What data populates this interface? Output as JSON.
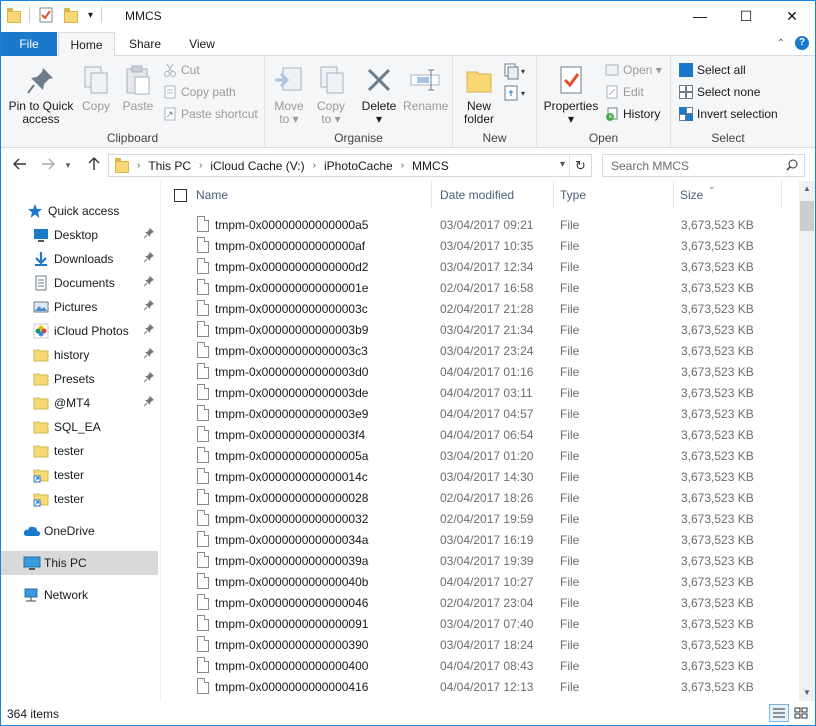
{
  "window": {
    "title": "MMCS",
    "minimize": "—",
    "maximize": "☐",
    "close": "✕"
  },
  "ribbon_tabs": {
    "file": "File",
    "home": "Home",
    "share": "Share",
    "view": "View"
  },
  "ribbon": {
    "clipboard": {
      "label": "Clipboard",
      "pin_line1": "Pin to Quick",
      "pin_line2": "access",
      "copy": "Copy",
      "paste": "Paste",
      "cut": "Cut",
      "copy_path": "Copy path",
      "paste_shortcut": "Paste shortcut"
    },
    "organise": {
      "label": "Organise",
      "move_to_1": "Move",
      "move_to_2": "to ▾",
      "copy_to_1": "Copy",
      "copy_to_2": "to ▾",
      "delete": "Delete",
      "delete_arrow": "▾",
      "rename": "Rename"
    },
    "new": {
      "label": "New",
      "new_folder_1": "New",
      "new_folder_2": "folder"
    },
    "open": {
      "label": "Open",
      "properties": "Properties",
      "properties_arrow": "▾",
      "open": "Open ▾",
      "edit": "Edit",
      "history": "History"
    },
    "select": {
      "label": "Select",
      "select_all": "Select all",
      "select_none": "Select none",
      "invert_selection": "Invert selection"
    }
  },
  "address": {
    "crumbs": [
      "This PC",
      "iCloud Cache (V:)",
      "iPhotoCache",
      "MMCS"
    ],
    "search_placeholder": "Search MMCS"
  },
  "nav": {
    "quick_access": "Quick access",
    "items": [
      {
        "label": "Desktop",
        "icon": "desktop-icon",
        "pinned": true
      },
      {
        "label": "Downloads",
        "icon": "downloads-icon",
        "pinned": true
      },
      {
        "label": "Documents",
        "icon": "documents-icon",
        "pinned": true
      },
      {
        "label": "Pictures",
        "icon": "pictures-icon",
        "pinned": true
      },
      {
        "label": "iCloud Photos",
        "icon": "icloud-photos-icon",
        "pinned": true
      },
      {
        "label": "history",
        "icon": "folder-icon",
        "pinned": true
      },
      {
        "label": "Presets",
        "icon": "folder-icon",
        "pinned": true
      },
      {
        "label": "@MT4",
        "icon": "folder-icon",
        "pinned": true
      },
      {
        "label": "SQL_EA",
        "icon": "folder-icon",
        "pinned": false
      },
      {
        "label": "tester",
        "icon": "folder-icon",
        "pinned": false
      },
      {
        "label": "tester",
        "icon": "folder-shortcut-icon",
        "pinned": false
      },
      {
        "label": "tester",
        "icon": "folder-shortcut-icon",
        "pinned": false
      }
    ],
    "onedrive": "OneDrive",
    "this_pc": "This PC",
    "network": "Network",
    "pin_glyph": "📌"
  },
  "columns": {
    "name": "Name",
    "date_modified": "Date modified",
    "type": "Type",
    "size": "Size"
  },
  "files": [
    {
      "name": "tmpm-0x00000000000000a5",
      "date": "03/04/2017 09:21",
      "type": "File",
      "size": "3,673,523 KB"
    },
    {
      "name": "tmpm-0x00000000000000af",
      "date": "03/04/2017 10:35",
      "type": "File",
      "size": "3,673,523 KB"
    },
    {
      "name": "tmpm-0x00000000000000d2",
      "date": "03/04/2017 12:34",
      "type": "File",
      "size": "3,673,523 KB"
    },
    {
      "name": "tmpm-0x000000000000001e",
      "date": "02/04/2017 16:58",
      "type": "File",
      "size": "3,673,523 KB"
    },
    {
      "name": "tmpm-0x000000000000003c",
      "date": "02/04/2017 21:28",
      "type": "File",
      "size": "3,673,523 KB"
    },
    {
      "name": "tmpm-0x00000000000003b9",
      "date": "03/04/2017 21:34",
      "type": "File",
      "size": "3,673,523 KB"
    },
    {
      "name": "tmpm-0x00000000000003c3",
      "date": "03/04/2017 23:24",
      "type": "File",
      "size": "3,673,523 KB"
    },
    {
      "name": "tmpm-0x00000000000003d0",
      "date": "04/04/2017 01:16",
      "type": "File",
      "size": "3,673,523 KB"
    },
    {
      "name": "tmpm-0x00000000000003de",
      "date": "04/04/2017 03:11",
      "type": "File",
      "size": "3,673,523 KB"
    },
    {
      "name": "tmpm-0x00000000000003e9",
      "date": "04/04/2017 04:57",
      "type": "File",
      "size": "3,673,523 KB"
    },
    {
      "name": "tmpm-0x00000000000003f4",
      "date": "04/04/2017 06:54",
      "type": "File",
      "size": "3,673,523 KB"
    },
    {
      "name": "tmpm-0x000000000000005a",
      "date": "03/04/2017 01:20",
      "type": "File",
      "size": "3,673,523 KB"
    },
    {
      "name": "tmpm-0x000000000000014c",
      "date": "03/04/2017 14:30",
      "type": "File",
      "size": "3,673,523 KB"
    },
    {
      "name": "tmpm-0x0000000000000028",
      "date": "02/04/2017 18:26",
      "type": "File",
      "size": "3,673,523 KB"
    },
    {
      "name": "tmpm-0x0000000000000032",
      "date": "02/04/2017 19:59",
      "type": "File",
      "size": "3,673,523 KB"
    },
    {
      "name": "tmpm-0x000000000000034a",
      "date": "03/04/2017 16:19",
      "type": "File",
      "size": "3,673,523 KB"
    },
    {
      "name": "tmpm-0x000000000000039a",
      "date": "03/04/2017 19:39",
      "type": "File",
      "size": "3,673,523 KB"
    },
    {
      "name": "tmpm-0x000000000000040b",
      "date": "04/04/2017 10:27",
      "type": "File",
      "size": "3,673,523 KB"
    },
    {
      "name": "tmpm-0x0000000000000046",
      "date": "02/04/2017 23:04",
      "type": "File",
      "size": "3,673,523 KB"
    },
    {
      "name": "tmpm-0x0000000000000091",
      "date": "03/04/2017 07:40",
      "type": "File",
      "size": "3,673,523 KB"
    },
    {
      "name": "tmpm-0x0000000000000390",
      "date": "03/04/2017 18:24",
      "type": "File",
      "size": "3,673,523 KB"
    },
    {
      "name": "tmpm-0x0000000000000400",
      "date": "04/04/2017 08:43",
      "type": "File",
      "size": "3,673,523 KB"
    },
    {
      "name": "tmpm-0x0000000000000416",
      "date": "04/04/2017 12:13",
      "type": "File",
      "size": "3,673,523 KB"
    }
  ],
  "status": {
    "item_count": "364 items"
  },
  "colors": {
    "accent": "#1979ca",
    "folder": "#f8d775",
    "selected_nav": "#d9d9d9"
  }
}
